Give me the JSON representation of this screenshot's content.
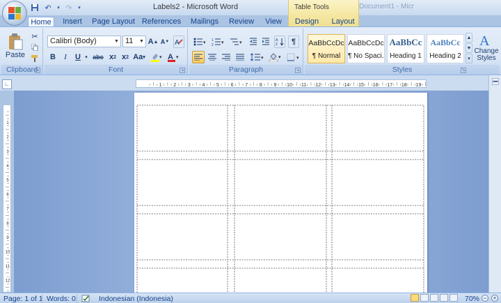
{
  "window": {
    "title": "Labels2 - Microsoft Word",
    "contextual_tab_group": "Table Tools",
    "background_window_title": "Document1 - Micr"
  },
  "tabs": [
    "Home",
    "Insert",
    "Page Layout",
    "References",
    "Mailings",
    "Review",
    "View",
    "Design",
    "Layout"
  ],
  "active_tab": "Home",
  "clipboard": {
    "label": "Clipboard",
    "paste": "Paste"
  },
  "font": {
    "label": "Font",
    "family": "Calibri (Body)",
    "size": "11"
  },
  "paragraph": {
    "label": "Paragraph"
  },
  "styles": {
    "label": "Styles",
    "items": [
      {
        "preview": "AaBbCcDc",
        "name": "¶ Normal"
      },
      {
        "preview": "AaBbCcDc",
        "name": "¶ No Spaci..."
      },
      {
        "preview": "AaBbCc",
        "name": "Heading 1"
      },
      {
        "preview": "AaBbCc",
        "name": "Heading 2"
      }
    ],
    "change_styles": "Change Styles"
  },
  "status": {
    "page": "Page: 1 of 1",
    "words": "Words: 0",
    "language": "Indonesian (Indonesia)",
    "zoom": "70%"
  },
  "ruler_h_labels": [
    "1",
    "2",
    "3",
    "4",
    "5",
    "6",
    "7",
    "8",
    "9",
    "10",
    "11",
    "12",
    "13",
    "14",
    "15",
    "16",
    "17",
    "18",
    "19"
  ],
  "ruler_v_labels": [
    "1",
    "2",
    "3",
    "4",
    "5",
    "6",
    "7",
    "8",
    "9",
    "10",
    "11",
    "12",
    "13"
  ],
  "colors": {
    "accent": "#15428b",
    "ribbon": "#dbe7f6",
    "workspace": "#a5bee3",
    "table_tools": "#f5e7a0"
  }
}
